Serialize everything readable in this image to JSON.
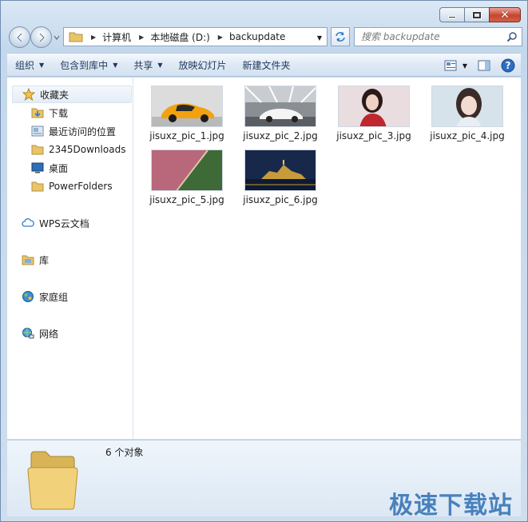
{
  "address": {
    "crumbs": [
      "计算机",
      "本地磁盘 (D:)",
      "backupdate"
    ]
  },
  "search": {
    "placeholder": "搜索 backupdate"
  },
  "toolbar": {
    "organize": "组织",
    "include_in_library": "包含到库中",
    "share": "共享",
    "slideshow": "放映幻灯片",
    "new_folder": "新建文件夹"
  },
  "navpane": {
    "favorites": "收藏夹",
    "favorites_items": [
      "下载",
      "最近访问的位置",
      "2345Downloads",
      "桌面",
      "PowerFolders"
    ],
    "wps": "WPS云文档",
    "library": "库",
    "homegroup": "家庭组",
    "network": "网络"
  },
  "files": [
    {
      "name": "jisuxz_pic_1.jpg"
    },
    {
      "name": "jisuxz_pic_2.jpg"
    },
    {
      "name": "jisuxz_pic_3.jpg"
    },
    {
      "name": "jisuxz_pic_4.jpg"
    },
    {
      "name": "jisuxz_pic_5.jpg"
    },
    {
      "name": "jisuxz_pic_6.jpg"
    }
  ],
  "status": {
    "count": "6 个对象"
  },
  "watermark": "极速下载站",
  "colors": {
    "accent": "#2f6fb3",
    "close": "#c8452f"
  }
}
